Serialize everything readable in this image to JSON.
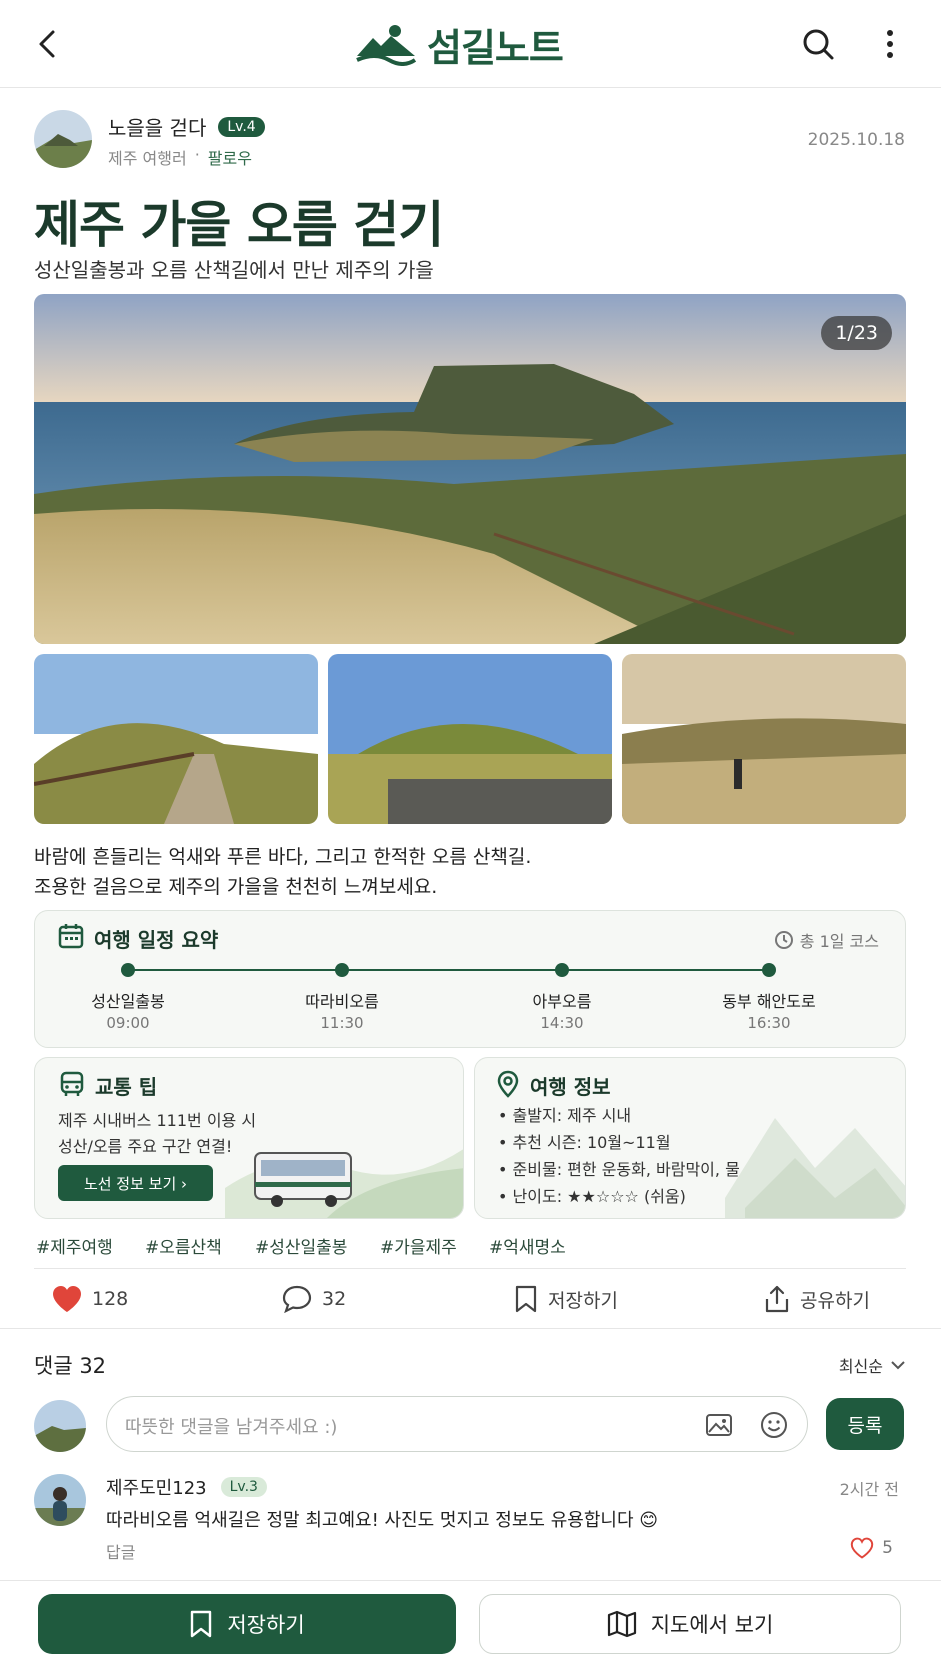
{
  "header": {
    "logo_text": "섬길노트",
    "back_icon": "chevron-left-icon",
    "search_icon": "search-icon",
    "more_icon": "more-vertical-icon"
  },
  "author": {
    "name": "노을을 걷다",
    "level": "Lv.4",
    "subtitle": "제주 여행러",
    "follow": "팔로우",
    "date": "2025.10.18"
  },
  "post": {
    "title": "제주 가을 오름 걷기",
    "subtitle": "성산일출봉과 오름 산책길에서 만난 제주의 가을",
    "photo_counter": "1/23",
    "body_line1": "바람에 흔들리는 억새와 푸른 바다, 그리고 한적한 오름 산책길.",
    "body_line2": "조용한 걸음으로 제주의 가을을 천천히 느껴보세요."
  },
  "itinerary": {
    "title": "여행 일정 요약",
    "course": "총 1일 코스",
    "stops": [
      {
        "name": "성산일출봉",
        "time": "09:00"
      },
      {
        "name": "따라비오름",
        "time": "11:30"
      },
      {
        "name": "아부오름",
        "time": "14:30"
      },
      {
        "name": "동부 해안도로",
        "time": "16:30"
      }
    ]
  },
  "transport": {
    "title": "교통 팁",
    "line1": "제주 시내버스 111번 이용 시",
    "line2": "성산/오름 주요 구간 연결!",
    "button": "노선 정보 보기 ›"
  },
  "trip_info": {
    "title": "여행 정보",
    "items": [
      "출발지: 제주 시내",
      "추천 시즌: 10월~11월",
      "준비물: 편한 운동화, 바람막이, 물",
      "난이도: ★★☆☆☆ (쉬움)"
    ]
  },
  "tags": [
    "#제주여행",
    "#오름산책",
    "#성산일출봉",
    "#가을제주",
    "#억새명소"
  ],
  "actions": {
    "likes": "128",
    "comments": "32",
    "save": "저장하기",
    "share": "공유하기"
  },
  "comments": {
    "heading": "댓글 32",
    "sort": "최신순",
    "input_placeholder": "따뜻한 댓글을 남겨주세요 :)",
    "submit": "등록",
    "list": [
      {
        "user": "제주도민123",
        "level": "Lv.3",
        "time": "2시간 전",
        "text": "따라비오름 억새길은 정말 최고예요! 사진도 멋지고 정보도 유용합니다 😊",
        "reply": "답글",
        "likes": "5"
      }
    ]
  },
  "bottom_bar": {
    "save": "저장하기",
    "map": "지도에서 보기"
  },
  "colors": {
    "brand_green": "#1f5a3e",
    "like_red": "#e0453a"
  }
}
